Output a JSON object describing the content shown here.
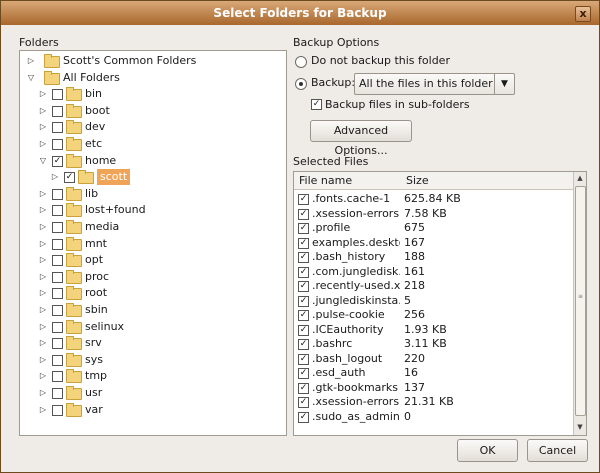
{
  "window": {
    "title": "Select Folders for Backup",
    "close_glyph": "x"
  },
  "folders_label": "Folders",
  "tree": [
    {
      "label": "Scott's Common Folders",
      "expander": "closed",
      "special": true
    },
    {
      "label": "All Folders",
      "expander": "open",
      "special": true
    },
    {
      "label": "bin",
      "expander": "closed",
      "checked": false
    },
    {
      "label": "boot",
      "expander": "closed",
      "checked": false
    },
    {
      "label": "dev",
      "expander": "closed",
      "checked": false
    },
    {
      "label": "etc",
      "expander": "closed",
      "checked": false
    },
    {
      "label": "home",
      "expander": "open",
      "checked": true
    },
    {
      "label": "scott",
      "expander": "closed",
      "checked": true,
      "selected": true,
      "indent": 1
    },
    {
      "label": "lib",
      "expander": "closed",
      "checked": false
    },
    {
      "label": "lost+found",
      "expander": "closed",
      "checked": false
    },
    {
      "label": "media",
      "expander": "closed",
      "checked": false
    },
    {
      "label": "mnt",
      "expander": "closed",
      "checked": false
    },
    {
      "label": "opt",
      "expander": "closed",
      "checked": false
    },
    {
      "label": "proc",
      "expander": "closed",
      "checked": false
    },
    {
      "label": "root",
      "expander": "closed",
      "checked": false
    },
    {
      "label": "sbin",
      "expander": "closed",
      "checked": false
    },
    {
      "label": "selinux",
      "expander": "closed",
      "checked": false
    },
    {
      "label": "srv",
      "expander": "closed",
      "checked": false
    },
    {
      "label": "sys",
      "expander": "closed",
      "checked": false
    },
    {
      "label": "tmp",
      "expander": "closed",
      "checked": false
    },
    {
      "label": "usr",
      "expander": "closed",
      "checked": false
    },
    {
      "label": "var",
      "expander": "closed",
      "checked": false
    }
  ],
  "backup_options": {
    "heading": "Backup Options",
    "no_backup_label": "Do not backup this folder",
    "backup_label": "Backup:",
    "backup_mode_value": "All the files in this folder",
    "subfolders_label": "Backup files in sub-folders",
    "subfolders_checked": true,
    "advanced_button": "Advanced Options..."
  },
  "selected_files": {
    "heading": "Selected Files",
    "columns": [
      "File name",
      "Size"
    ],
    "rows": [
      {
        "name": ".fonts.cache-1",
        "size": "625.84 KB"
      },
      {
        "name": ".xsession-errors",
        "size": "7.58 KB"
      },
      {
        "name": ".profile",
        "size": "675"
      },
      {
        "name": "examples.desktop",
        "size": "167"
      },
      {
        "name": ".bash_history",
        "size": "188"
      },
      {
        "name": ".com.jungledisk....",
        "size": "161"
      },
      {
        "name": ".recently-used.x...",
        "size": "218"
      },
      {
        "name": ".junglediskinsta...",
        "size": "5"
      },
      {
        "name": ".pulse-cookie",
        "size": "256"
      },
      {
        "name": ".ICEauthority",
        "size": "1.93 KB"
      },
      {
        "name": ".bashrc",
        "size": "3.11 KB"
      },
      {
        "name": ".bash_logout",
        "size": "220"
      },
      {
        "name": ".esd_auth",
        "size": "16"
      },
      {
        "name": ".gtk-bookmarks",
        "size": "137"
      },
      {
        "name": ".xsession-errors....",
        "size": "21.31 KB"
      },
      {
        "name": ".sudo_as_admin...",
        "size": "0"
      }
    ]
  },
  "buttons": {
    "ok": "OK",
    "cancel": "Cancel"
  },
  "colors": {
    "titlebar": "#b3723a",
    "selection": "#f0a458"
  }
}
